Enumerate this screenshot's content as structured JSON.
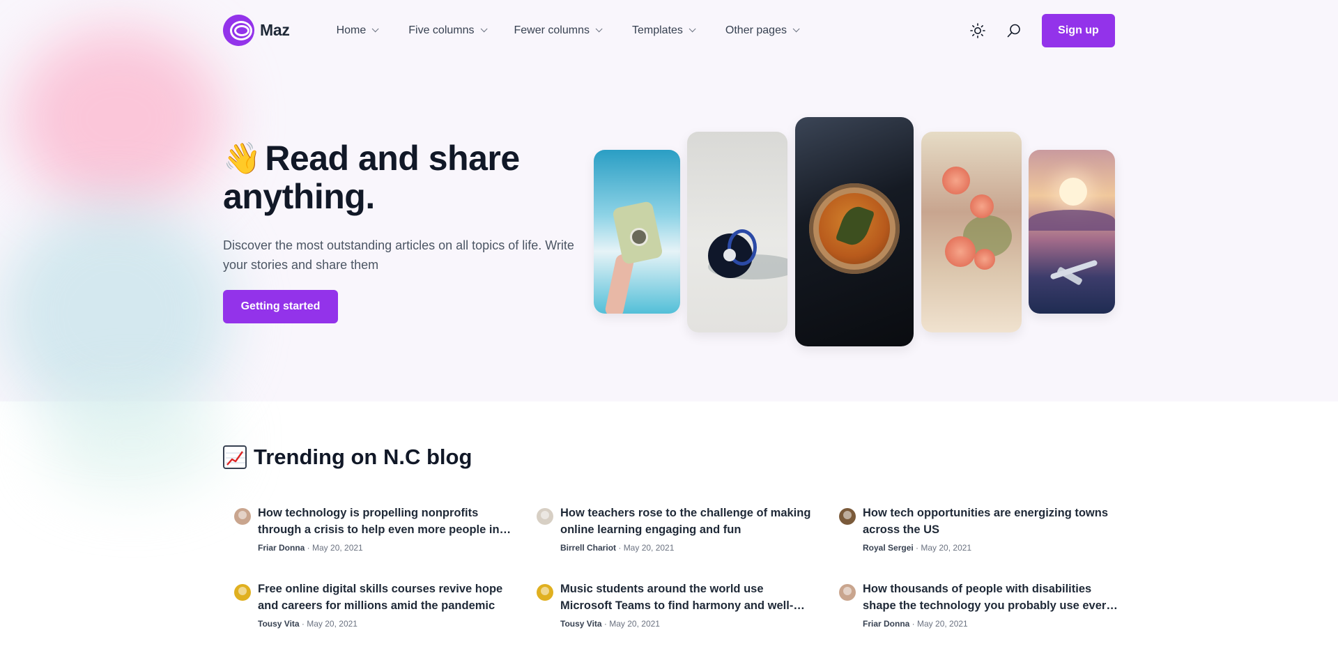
{
  "brand": {
    "name": "Maz",
    "accent": "#9333ea"
  },
  "nav": {
    "items": [
      {
        "label": "Home"
      },
      {
        "label": "Five columns"
      },
      {
        "label": "Fewer columns"
      },
      {
        "label": "Templates"
      },
      {
        "label": "Other pages"
      }
    ],
    "theme_icon": "sun-icon",
    "search_icon": "search-icon",
    "signup_label": "Sign up"
  },
  "hero": {
    "emoji": "👋",
    "title": "Read and share anything.",
    "description": "Discover the most outstanding articles on all topics of life. Write your stories and share them",
    "cta_label": "Getting started"
  },
  "trending": {
    "emoji": "📈",
    "title": "Trending on N.C blog",
    "items": [
      {
        "title": "How technology is propelling nonprofits through a crisis to help even more people in need",
        "author": "Friar Donna",
        "date": "May 20, 2021",
        "avatar_color": "#c9a58e"
      },
      {
        "title": "How teachers rose to the challenge of making online learning engaging and fun",
        "author": "Birrell Chariot",
        "date": "May 20, 2021",
        "avatar_color": "#d7cfc4"
      },
      {
        "title": "How tech opportunities are energizing towns across the US",
        "author": "Royal Sergei",
        "date": "May 20, 2021",
        "avatar_color": "#7a5a3a"
      },
      {
        "title": "Free online digital skills courses revive hope and careers for millions amid the pandemic",
        "author": "Tousy Vita",
        "date": "May 20, 2021",
        "avatar_color": "#e0b020"
      },
      {
        "title": "Music students around the world use Microsoft Teams to find harmony and well-being",
        "author": "Tousy Vita",
        "date": "May 20, 2021",
        "avatar_color": "#e0b020"
      },
      {
        "title": "How thousands of people with disabilities shape the technology you probably use every day",
        "author": "Friar Donna",
        "date": "May 20, 2021",
        "avatar_color": "#c9a58e"
      }
    ]
  }
}
